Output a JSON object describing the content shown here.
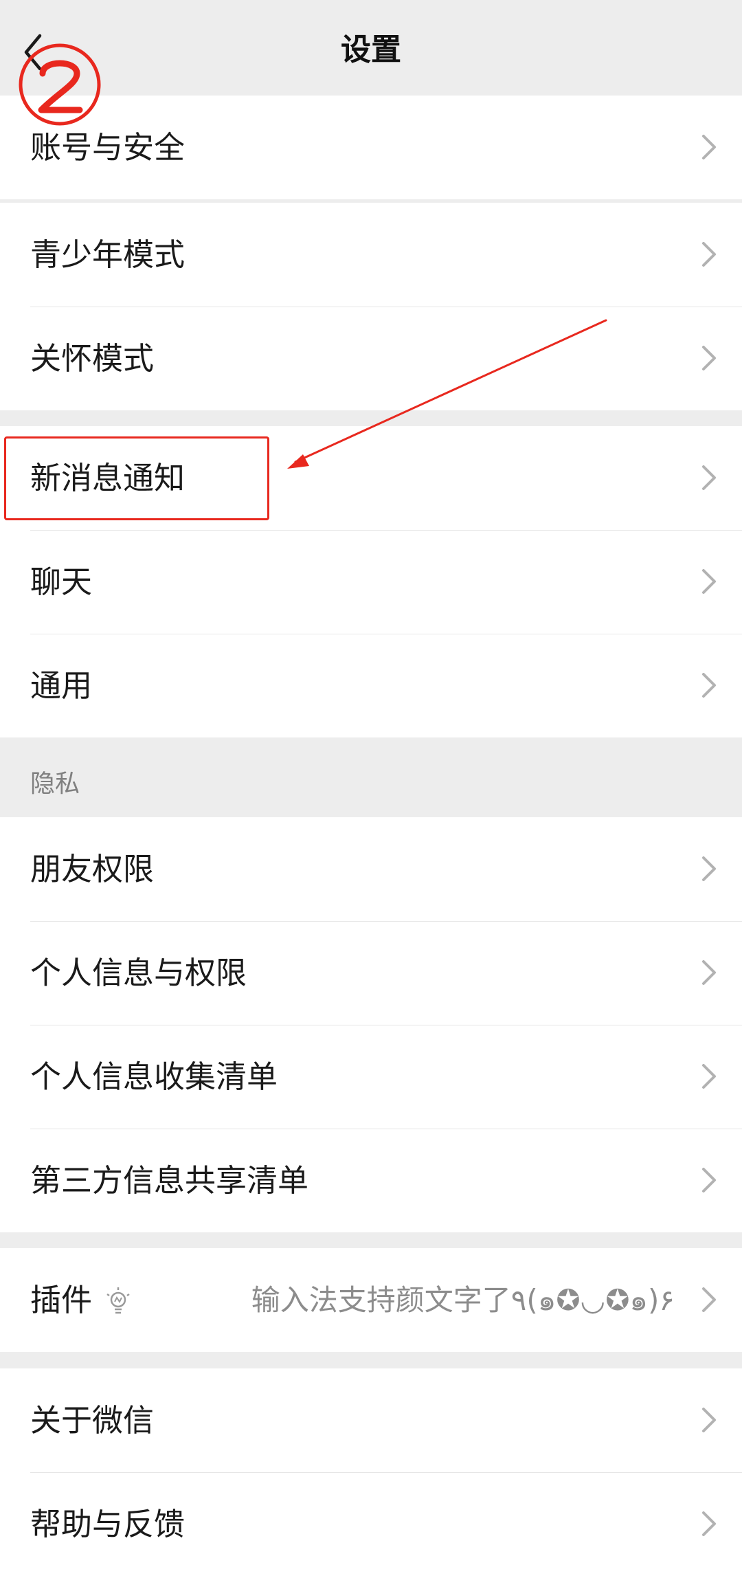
{
  "nav": {
    "title": "设置",
    "back_icon": "back-chevron-icon"
  },
  "annotation": {
    "step_number": "②",
    "color": "#e8281e"
  },
  "groups": [
    {
      "items": [
        {
          "label": "账号与安全"
        }
      ]
    },
    {
      "items": [
        {
          "label": "青少年模式"
        },
        {
          "label": "关怀模式"
        }
      ]
    },
    {
      "items": [
        {
          "label": "新消息通知"
        },
        {
          "label": "聊天"
        },
        {
          "label": "通用"
        }
      ]
    },
    {
      "header": "隐私",
      "items": [
        {
          "label": "朋友权限"
        },
        {
          "label": "个人信息与权限"
        },
        {
          "label": "个人信息收集清单"
        },
        {
          "label": "第三方信息共享清单"
        }
      ]
    },
    {
      "items": [
        {
          "label": "插件",
          "icon": "lightbulb-icon",
          "hint": "输入法支持颜文字了٩(๑✪◡✪๑)۶"
        }
      ]
    },
    {
      "items": [
        {
          "label": "关于微信"
        },
        {
          "label": "帮助与反馈"
        }
      ]
    }
  ]
}
